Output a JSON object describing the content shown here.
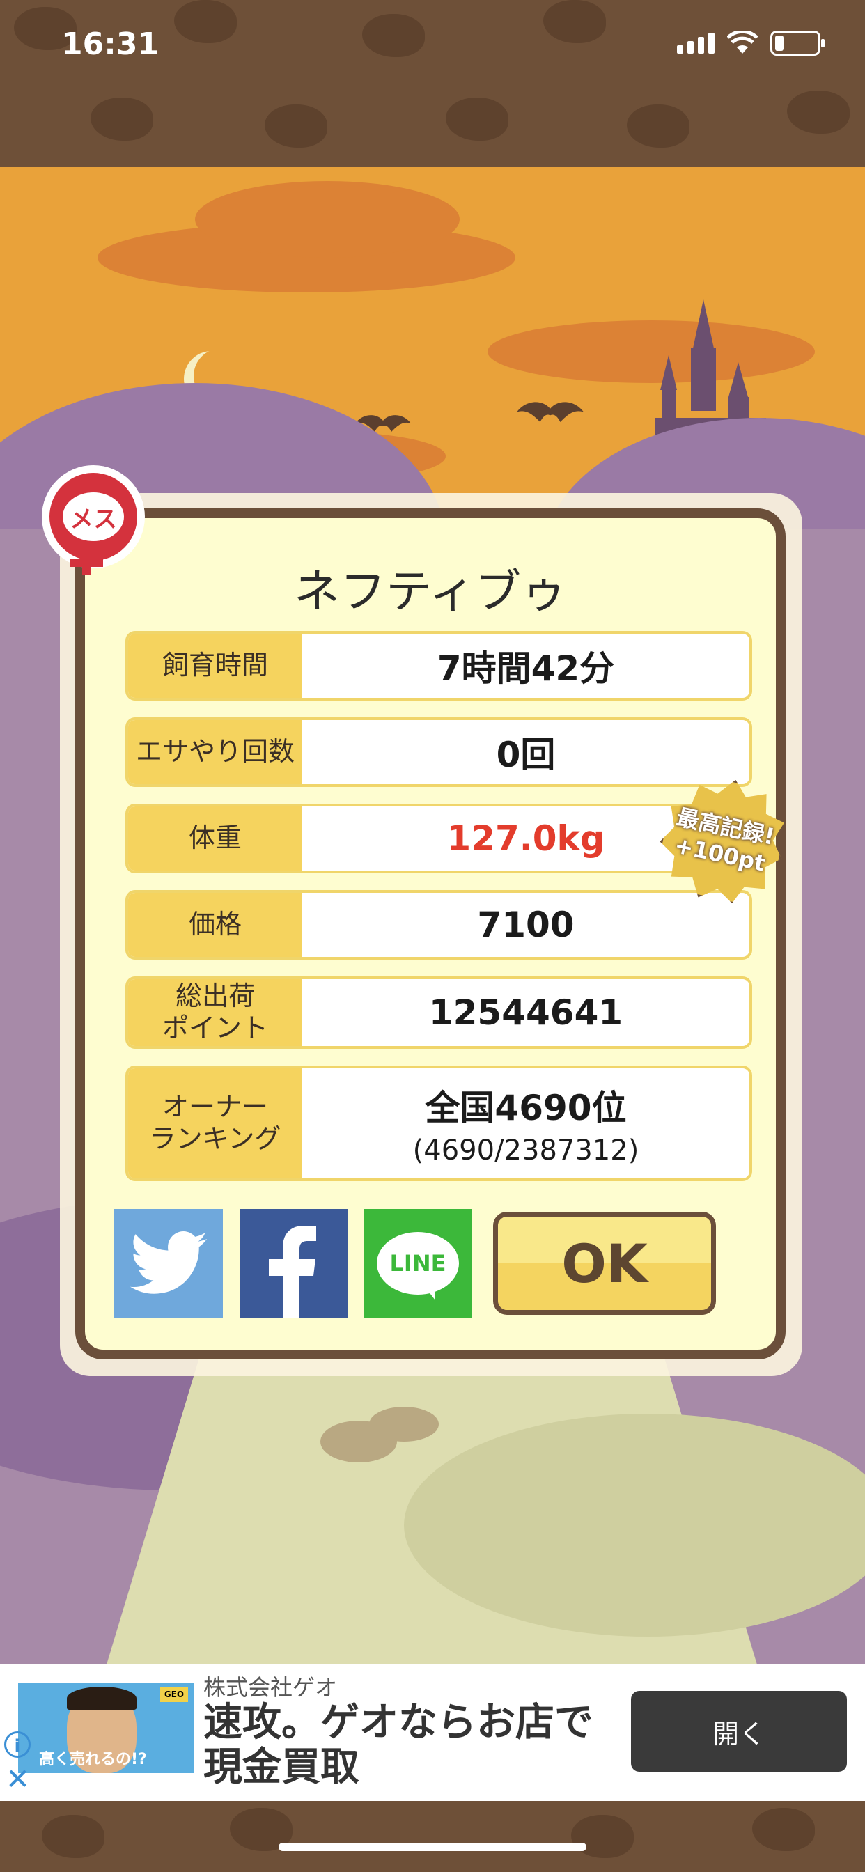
{
  "status": {
    "time": "16:31"
  },
  "pet": {
    "gender_label": "メス",
    "name": "ネフティブゥ"
  },
  "stats": [
    {
      "label": "飼育時間",
      "value": "7時間42分",
      "sub": ""
    },
    {
      "label": "エサやり回数",
      "value": "0回",
      "sub": ""
    },
    {
      "label": "体重",
      "value": "127.0kg",
      "sub": ""
    },
    {
      "label": "価格",
      "value": "7100",
      "sub": ""
    },
    {
      "label": "総出荷\nポイント",
      "value": "12544641",
      "sub": ""
    },
    {
      "label": "オーナー\nランキング",
      "value": "全国4690位",
      "sub": "(4690/2387312)"
    }
  ],
  "record_badge": {
    "line1": "最高記録!",
    "line2": "+100pt"
  },
  "buttons": {
    "line_label": "LINE",
    "ok_label": "OK"
  },
  "ad": {
    "company": "株式会社ゲオ",
    "headline": "速攻。ゲオならお店で現金買取",
    "image_caption": "高く売れるの!?",
    "image_logo": "GEO",
    "cta": "開く",
    "info_icon": "i",
    "close_icon": "✕"
  },
  "colors": {
    "accent_red": "#e33c2c",
    "label_yellow": "#f5d35e",
    "frame_brown": "#6b4f3a",
    "twitter": "#6fa8dc",
    "facebook": "#3b5998",
    "line": "#3cb83a"
  }
}
